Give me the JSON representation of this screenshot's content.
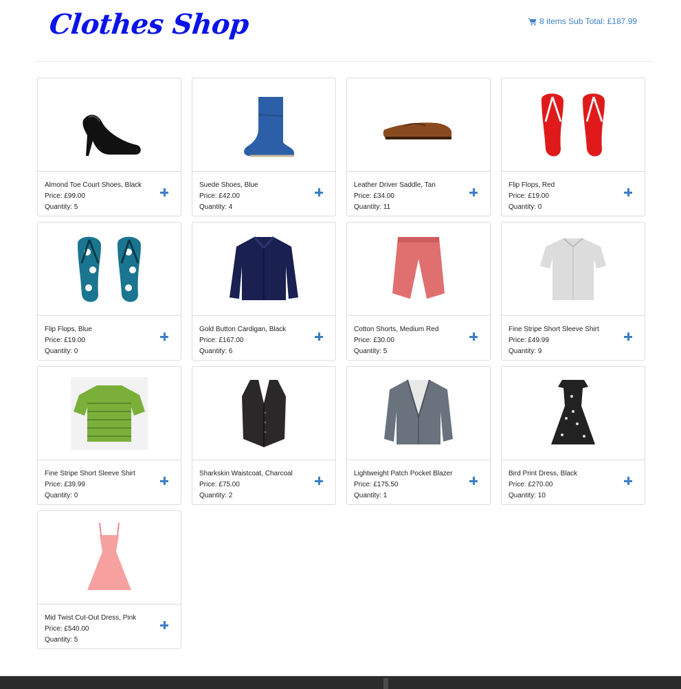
{
  "header": {
    "logo": "Clothes Shop",
    "cart_summary": "8 items Sub Total: £187.99",
    "cart_icon": "shopping-cart-icon"
  },
  "colors": {
    "logo": "#0a14e6",
    "accent": "#3b7fc4"
  },
  "products": [
    {
      "name": "Almond Toe Court Shoes, Black",
      "price": "Price: £99.00",
      "quantity": "Quantity: 5",
      "image": "black-court-shoe"
    },
    {
      "name": "Suede Shoes, Blue",
      "price": "Price: £42.00",
      "quantity": "Quantity: 4",
      "image": "blue-suede-boot"
    },
    {
      "name": "Leather Driver Saddle, Tan",
      "price": "Price: £34.00",
      "quantity": "Quantity: 11",
      "image": "tan-loafer"
    },
    {
      "name": "Flip Flops, Red",
      "price": "Price: £19.00",
      "quantity": "Quantity: 0",
      "image": "red-flip-flops"
    },
    {
      "name": "Flip Flops, Blue",
      "price": "Price: £19.00",
      "quantity": "Quantity: 0",
      "image": "blue-floral-flip-flops"
    },
    {
      "name": "Gold Button Cardigan, Black",
      "price": "Price: £167.00",
      "quantity": "Quantity: 6",
      "image": "navy-cardigan"
    },
    {
      "name": "Cotton Shorts, Medium Red",
      "price": "Price: £30.00",
      "quantity": "Quantity: 5",
      "image": "red-shorts"
    },
    {
      "name": "Fine Stripe Short Sleeve Shirt",
      "price": "Price: £49.99",
      "quantity": "Quantity: 9",
      "image": "grey-shirt"
    },
    {
      "name": "Fine Stripe Short Sleeve Shirt",
      "price": "Price: £39.99",
      "quantity": "Quantity: 0",
      "image": "green-polo"
    },
    {
      "name": "Sharkskin Waistcoat, Charcoal",
      "price": "Price: £75.00",
      "quantity": "Quantity: 2",
      "image": "charcoal-waistcoat"
    },
    {
      "name": "Lightweight Patch Pocket Blazer",
      "price": "Price: £175.50",
      "quantity": "Quantity: 1",
      "image": "grey-blazer"
    },
    {
      "name": "Bird Print Dress, Black",
      "price": "Price: £270.00",
      "quantity": "Quantity: 10",
      "image": "black-print-dress"
    },
    {
      "name": "Mid Twist Cut-Out Dress, Pink",
      "price": "Price: £540.00",
      "quantity": "Quantity: 5",
      "image": "pink-dress"
    }
  ]
}
